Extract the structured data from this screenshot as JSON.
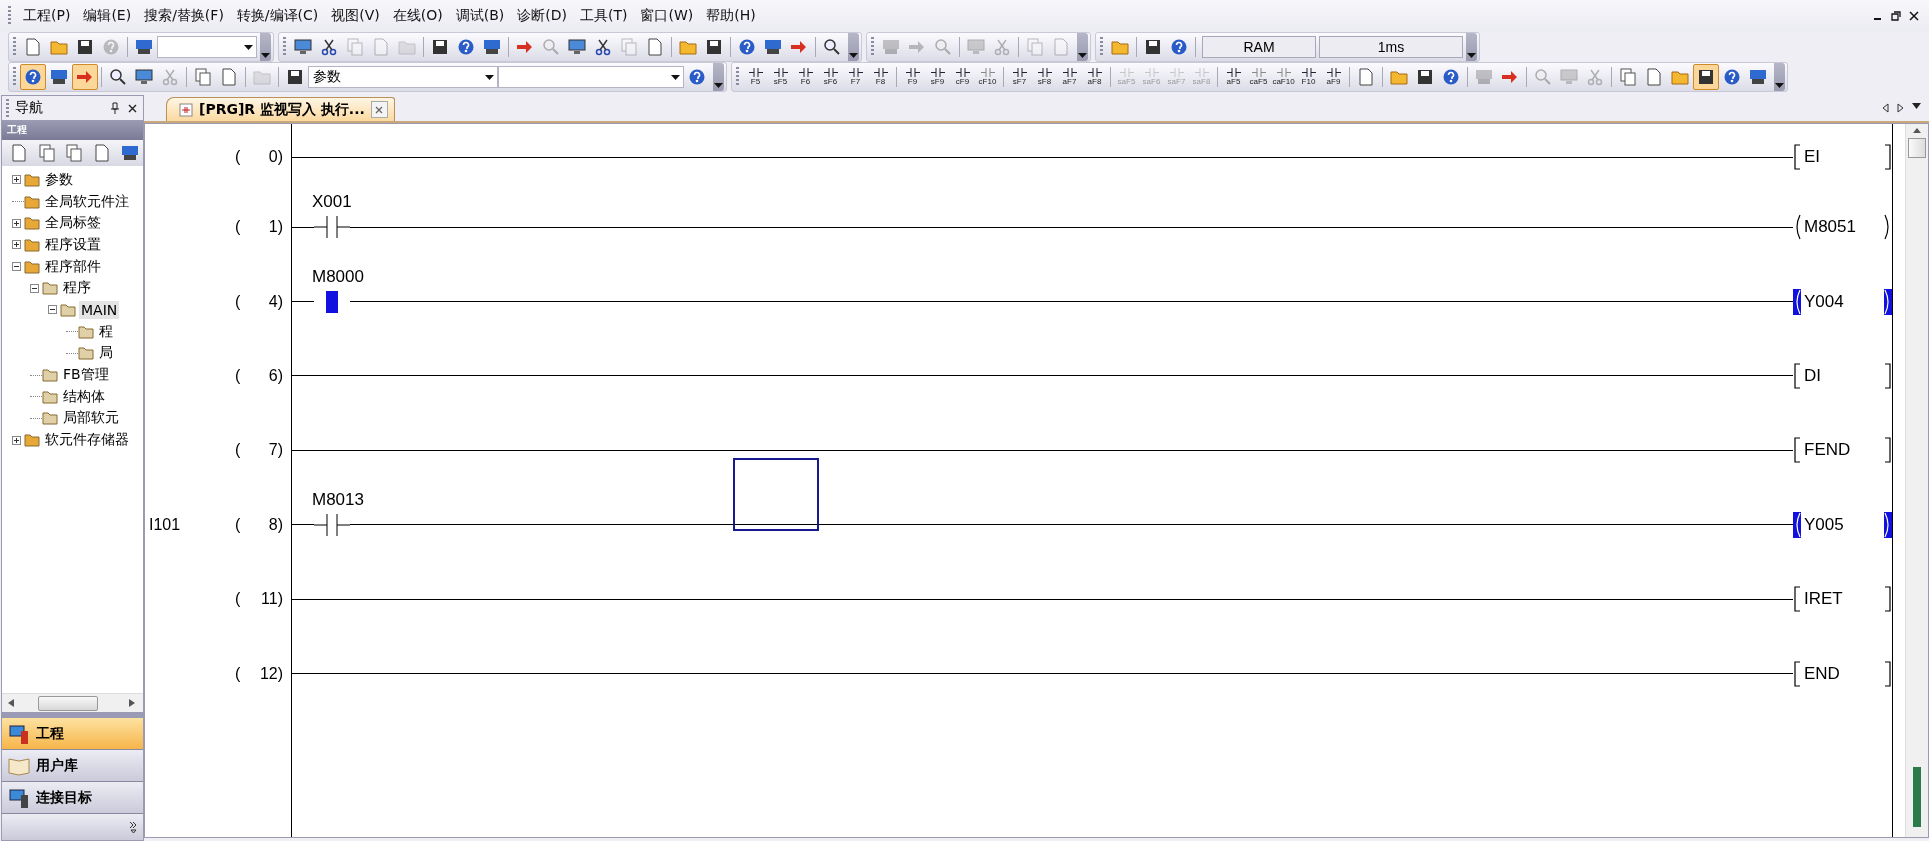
{
  "menu_bar": {
    "items": [
      "工程(P)",
      "编辑(E)",
      "搜索/替换(F)",
      "转换/编译(C)",
      "视图(V)",
      "在线(O)",
      "调试(B)",
      "诊断(D)",
      "工具(T)",
      "窗口(W)",
      "帮助(H)"
    ]
  },
  "toolbar_rows": [
    [
      [
        {
          "kind": "button",
          "disabled": false
        },
        {
          "kind": "button",
          "disabled": false
        },
        {
          "kind": "button",
          "disabled": false
        },
        {
          "kind": "button",
          "disabled": true
        },
        {
          "kind": "separator"
        },
        {
          "kind": "button",
          "disabled": false
        },
        {
          "kind": "combo"
        }
      ],
      [
        {
          "kind": "button",
          "disabled": false
        },
        {
          "kind": "button",
          "disabled": false
        },
        {
          "kind": "button",
          "disabled": true
        },
        {
          "kind": "button",
          "disabled": true
        },
        {
          "kind": "button",
          "disabled": true
        },
        {
          "kind": "separator"
        },
        {
          "kind": "button",
          "disabled": false
        },
        {
          "kind": "button",
          "disabled": false
        },
        {
          "kind": "button",
          "disabled": false
        },
        {
          "kind": "separator"
        },
        {
          "kind": "button",
          "disabled": false
        },
        {
          "kind": "button",
          "disabled": true
        },
        {
          "kind": "button",
          "disabled": false
        },
        {
          "kind": "button",
          "disabled": false
        },
        {
          "kind": "button",
          "disabled": true
        },
        {
          "kind": "button",
          "disabled": false
        },
        {
          "kind": "separator"
        },
        {
          "kind": "button",
          "disabled": false
        },
        {
          "kind": "button",
          "disabled": false
        },
        {
          "kind": "separator"
        },
        {
          "kind": "button",
          "disabled": false
        },
        {
          "kind": "button",
          "disabled": false
        },
        {
          "kind": "button",
          "disabled": false
        },
        {
          "kind": "separator"
        },
        {
          "kind": "button",
          "disabled": false
        }
      ],
      [
        {
          "kind": "button",
          "disabled": true
        },
        {
          "kind": "button",
          "disabled": true
        },
        {
          "kind": "button",
          "disabled": true
        },
        {
          "kind": "separator"
        },
        {
          "kind": "button",
          "disabled": true
        },
        {
          "kind": "button",
          "disabled": true
        },
        {
          "kind": "separator"
        },
        {
          "kind": "button",
          "disabled": true
        },
        {
          "kind": "button",
          "disabled": true
        }
      ],
      [
        {
          "kind": "button",
          "disabled": false
        },
        {
          "kind": "separator"
        },
        {
          "kind": "button",
          "disabled": false
        },
        {
          "kind": "button",
          "disabled": false
        },
        {
          "kind": "separator"
        },
        {
          "kind": "field",
          "value": "RAM"
        },
        {
          "kind": "field",
          "value": "1ms"
        }
      ]
    ],
    [
      [
        {
          "kind": "button",
          "disabled": false,
          "pressed": true
        },
        {
          "kind": "button",
          "disabled": false,
          "pressed": false
        },
        {
          "kind": "button",
          "disabled": false,
          "pressed": true
        },
        {
          "kind": "separator"
        },
        {
          "kind": "button",
          "disabled": false,
          "pressed": false
        },
        {
          "kind": "button",
          "disabled": false,
          "pressed": false
        },
        {
          "kind": "button",
          "disabled": true,
          "pressed": false
        },
        {
          "kind": "separator"
        },
        {
          "kind": "button",
          "disabled": false,
          "pressed": false
        },
        {
          "kind": "button",
          "disabled": false,
          "pressed": false
        },
        {
          "kind": "separator"
        },
        {
          "kind": "button",
          "disabled": true,
          "pressed": false
        },
        {
          "kind": "separator"
        },
        {
          "kind": "button",
          "disabled": false,
          "pressed": false
        },
        {
          "kind": "combo",
          "value": "参数"
        },
        {
          "kind": "combo"
        },
        {
          "kind": "button",
          "disabled": false,
          "pressed": false
        }
      ],
      [
        {
          "kind": "fkey",
          "label": "F5",
          "disabled": false
        },
        {
          "kind": "fkey",
          "label": "sF5",
          "disabled": false
        },
        {
          "kind": "fkey",
          "label": "F6",
          "disabled": false
        },
        {
          "kind": "fkey",
          "label": "sF6",
          "disabled": false
        },
        {
          "kind": "fkey",
          "label": "F7",
          "disabled": false
        },
        {
          "kind": "fkey",
          "label": "F8",
          "disabled": false
        },
        {
          "kind": "separator"
        },
        {
          "kind": "fkey",
          "label": "F9",
          "disabled": false
        },
        {
          "kind": "fkey",
          "label": "sF9",
          "disabled": false
        },
        {
          "kind": "fkey",
          "label": "cF9",
          "disabled": false
        },
        {
          "kind": "fkey",
          "label": "cF10",
          "disabled": false
        },
        {
          "kind": "separator"
        },
        {
          "kind": "fkey",
          "label": "sF7",
          "disabled": false
        },
        {
          "kind": "fkey",
          "label": "sF8",
          "disabled": false
        },
        {
          "kind": "fkey",
          "label": "aF7",
          "disabled": false
        },
        {
          "kind": "fkey",
          "label": "aF8",
          "disabled": false
        },
        {
          "kind": "separator"
        },
        {
          "kind": "fkey",
          "label": "saF5",
          "disabled": true
        },
        {
          "kind": "fkey",
          "label": "saF6",
          "disabled": true
        },
        {
          "kind": "fkey",
          "label": "saF7",
          "disabled": true
        },
        {
          "kind": "fkey",
          "label": "saF8",
          "disabled": true
        },
        {
          "kind": "separator"
        },
        {
          "kind": "fkey",
          "label": "aF5",
          "disabled": false
        },
        {
          "kind": "fkey",
          "label": "caF5",
          "disabled": false
        },
        {
          "kind": "fkey",
          "label": "caF10",
          "disabled": false
        },
        {
          "kind": "fkey",
          "label": "F10",
          "disabled": false
        },
        {
          "kind": "fkey",
          "label": "aF9",
          "disabled": false
        },
        {
          "kind": "separator"
        },
        {
          "kind": "button",
          "disabled": false,
          "pressed": false
        },
        {
          "kind": "separator"
        },
        {
          "kind": "button",
          "disabled": false,
          "pressed": false
        },
        {
          "kind": "button",
          "disabled": false,
          "pressed": false
        },
        {
          "kind": "button",
          "disabled": false,
          "pressed": false
        },
        {
          "kind": "separator"
        },
        {
          "kind": "button",
          "disabled": true,
          "pressed": false
        },
        {
          "kind": "button",
          "disabled": false,
          "pressed": false
        },
        {
          "kind": "separator"
        },
        {
          "kind": "button",
          "disabled": true,
          "pressed": false
        },
        {
          "kind": "button",
          "disabled": true,
          "pressed": false
        },
        {
          "kind": "button",
          "disabled": true,
          "pressed": false
        },
        {
          "kind": "separator"
        },
        {
          "kind": "button",
          "disabled": false,
          "pressed": false
        },
        {
          "kind": "button",
          "disabled": false,
          "pressed": false
        },
        {
          "kind": "button",
          "disabled": false,
          "pressed": false
        },
        {
          "kind": "button",
          "disabled": false,
          "pressed": true
        },
        {
          "kind": "button",
          "disabled": false,
          "pressed": false
        },
        {
          "kind": "button",
          "disabled": false,
          "pressed": false
        }
      ]
    ]
  ],
  "navigation": {
    "title": "导航",
    "section": "工程",
    "tree": [
      {
        "label": "参数",
        "expanded": false,
        "selected": false
      },
      {
        "label": "全局软元件注",
        "selected": false
      },
      {
        "label": "全局标签",
        "expanded": false,
        "selected": false
      },
      {
        "label": "程序设置",
        "expanded": false,
        "selected": false
      },
      {
        "label": "程序部件",
        "expanded": true,
        "selected": false,
        "children": [
          {
            "label": "程序",
            "expanded": true,
            "selected": false,
            "children": [
              {
                "label": "MAIN",
                "expanded": true,
                "selected": true,
                "children": [
                  {
                    "label": "程",
                    "selected": false
                  },
                  {
                    "label": "局",
                    "selected": false
                  }
                ]
              }
            ]
          },
          {
            "label": "FB管理",
            "selected": false
          },
          {
            "label": "结构体",
            "selected": false
          },
          {
            "label": "局部软元",
            "selected": false
          }
        ]
      },
      {
        "label": "软元件存储器",
        "expanded": false,
        "selected": false
      }
    ],
    "panes": [
      {
        "label": "工程",
        "selected": true
      },
      {
        "label": "用户库",
        "selected": false
      },
      {
        "label": "连接目标",
        "selected": false
      }
    ]
  },
  "tabs": [
    {
      "label": "[PRG]R 监视写入 执行...",
      "selected": true
    }
  ],
  "ladder": {
    "rungs": [
      {
        "step_open": "(",
        "step": "0)",
        "output": {
          "kind": "instruction",
          "text": "EI",
          "energized": false
        },
        "cursor": false
      },
      {
        "step_open": "(",
        "step": "1)",
        "contact": {
          "device": "X001",
          "energized": false
        },
        "output": {
          "kind": "coil",
          "text": "M8051",
          "energized": false
        },
        "cursor": false
      },
      {
        "step_open": "(",
        "step": "4)",
        "contact": {
          "device": "M8000",
          "energized": true
        },
        "output": {
          "kind": "coil",
          "text": "Y004",
          "energized": true
        },
        "cursor": false
      },
      {
        "step_open": "(",
        "step": "6)",
        "output": {
          "kind": "instruction",
          "text": "DI",
          "energized": false
        },
        "cursor": false
      },
      {
        "step_open": "(",
        "step": "7)",
        "output": {
          "kind": "instruction",
          "text": "FEND",
          "energized": false
        },
        "cursor": false
      },
      {
        "label": "I101",
        "step_open": "(",
        "step": "8)",
        "contact": {
          "device": "M8013",
          "energized": false
        },
        "output": {
          "kind": "coil",
          "text": "Y005",
          "energized": true
        },
        "cursor": true
      },
      {
        "step_open": "(",
        "step": "11)",
        "output": {
          "kind": "instruction",
          "text": "IRET",
          "energized": false
        },
        "cursor": false
      },
      {
        "step_open": "(",
        "step": "12)",
        "output": {
          "kind": "instruction",
          "text": "END",
          "energized": false
        },
        "cursor": false
      }
    ]
  }
}
